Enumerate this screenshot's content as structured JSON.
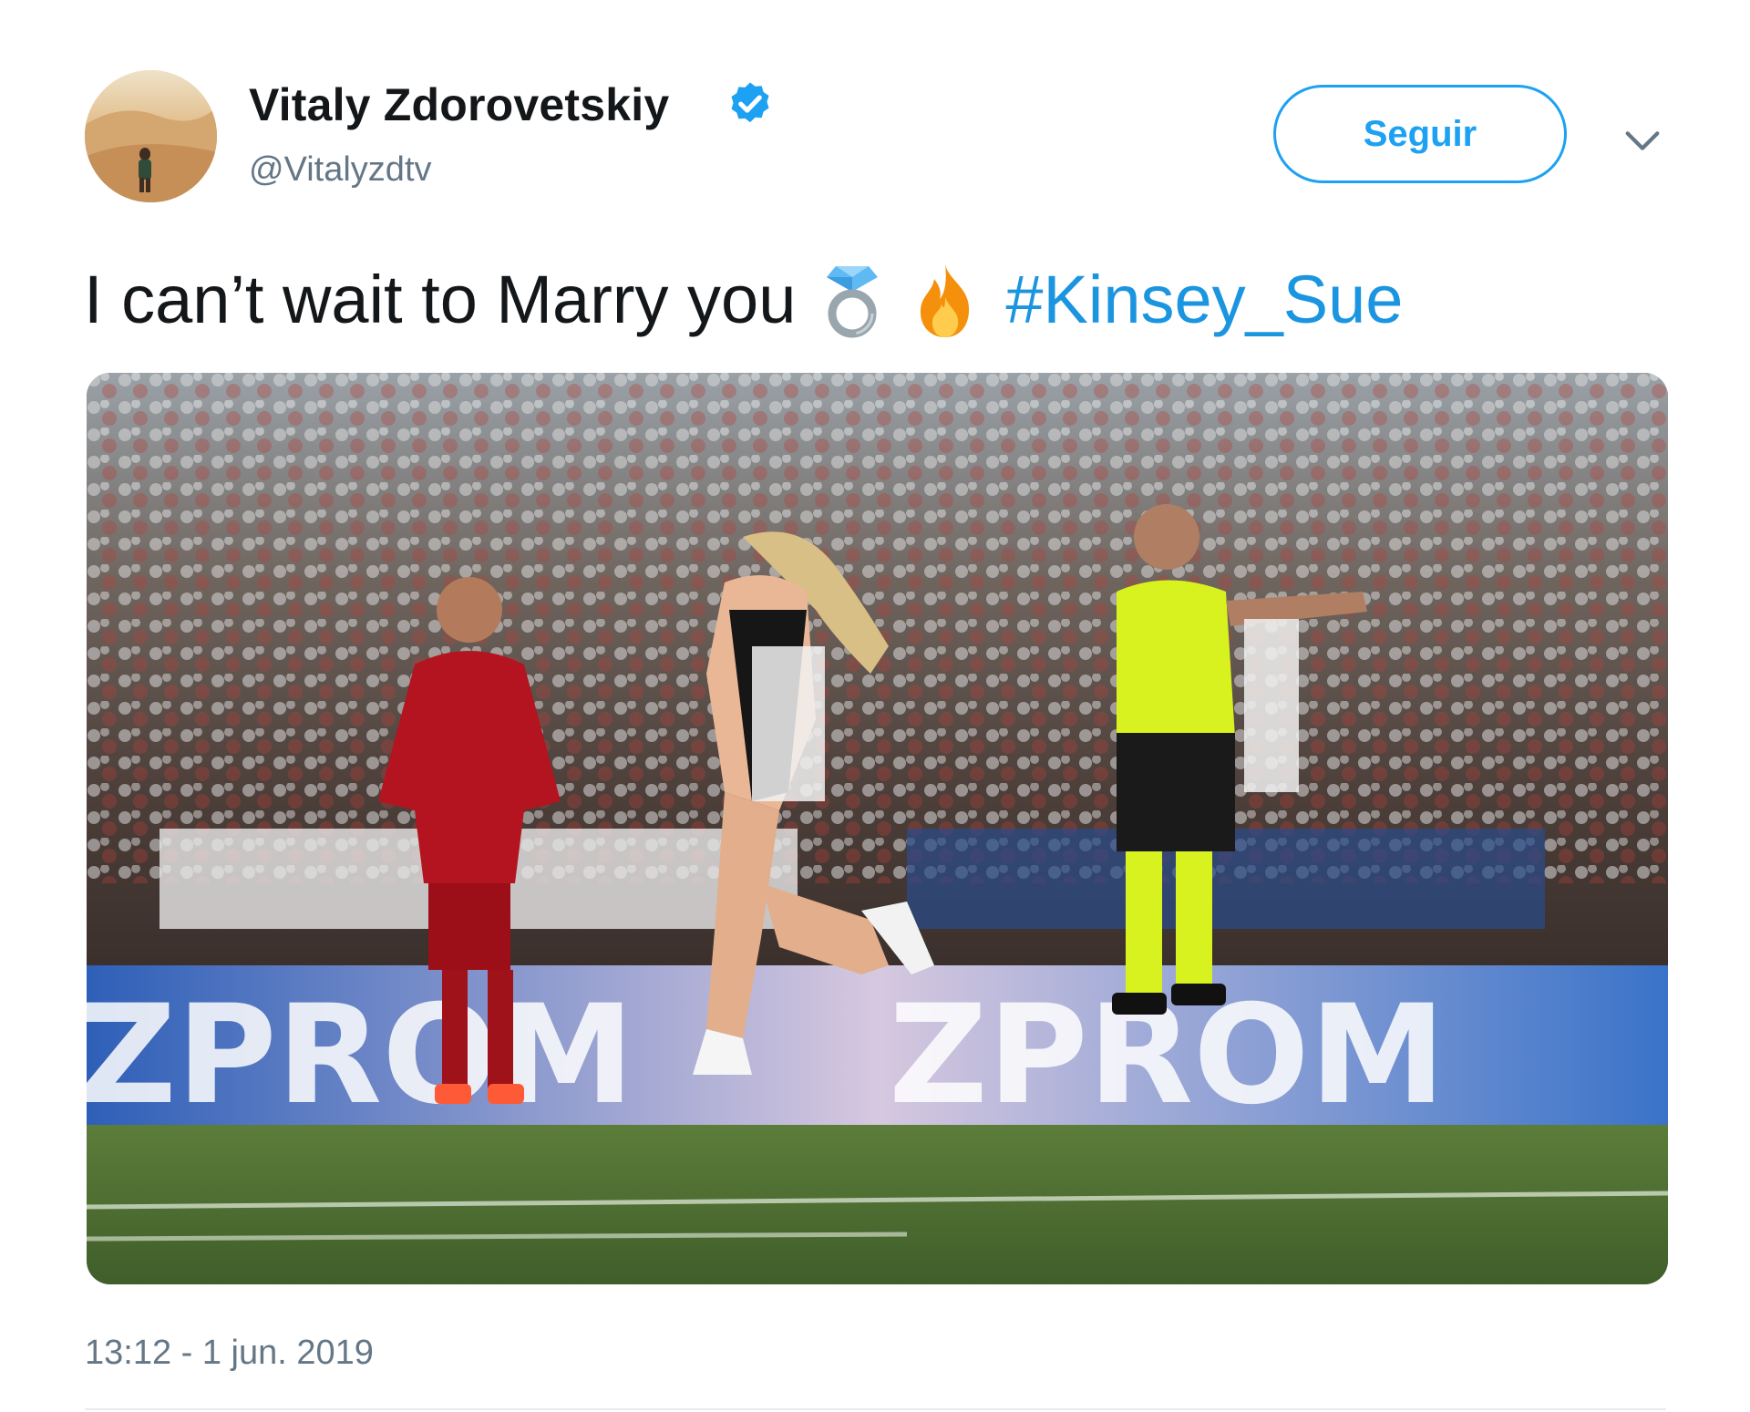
{
  "user": {
    "display_name": "Vitaly Zdorovetskiy",
    "handle": "@Vitalyzdtv",
    "verified": true,
    "avatar_icon": "avatar-desert-photo",
    "verified_icon": "verified-badge-icon"
  },
  "actions": {
    "follow_label": "Seguir",
    "more_icon": "chevron-down-icon"
  },
  "tweet": {
    "text": "I can’t wait to Marry you",
    "emojis": [
      "ring-emoji",
      "fire-emoji"
    ],
    "hashtag": "#Kinsey_Sue",
    "timestamp": "13:12 - 1 jun. 2019"
  },
  "photo": {
    "banner_text": "ZPROM"
  },
  "colors": {
    "accent": "#1da1f2",
    "hashtag": "#1b95e0",
    "muted": "#657786",
    "text": "#14171a",
    "divider": "#e6ecf0"
  }
}
